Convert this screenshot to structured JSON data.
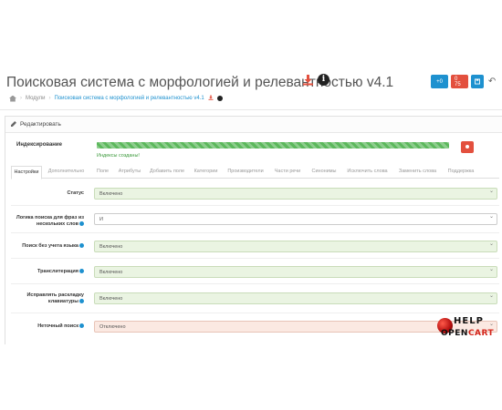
{
  "header": {
    "title": "Поисковая система с морфологией и релевантностью v4.1",
    "buttons": {
      "copy": "+0",
      "delete": "0 75",
      "save": "",
      "back": "↶"
    }
  },
  "breadcrumb": {
    "modules": "Модули",
    "current": "Поисковая система с морфологией и релевантностью v4.1"
  },
  "panel": {
    "heading": "Редактировать"
  },
  "indexing": {
    "label": "Индексирование",
    "status": "Индексы созданы!",
    "progress": 100
  },
  "tabs": [
    "Настройки",
    "Дополнительно",
    "Поле",
    "Атрибуты",
    "Добавить поле",
    "Категории",
    "Производители",
    "Части речи",
    "Синонимы",
    "Исключить слова",
    "Заменить слова",
    "Поддержка"
  ],
  "fields": [
    {
      "label": "Статус",
      "value": "Включено",
      "style": "green",
      "help": false
    },
    {
      "label": "Логика поиска для фраз из нескольких слов",
      "value": "И",
      "style": "plain",
      "help": true
    },
    {
      "label": "Поиск без учета языка",
      "value": "Включено",
      "style": "green",
      "help": true
    },
    {
      "label": "Транслитерация",
      "value": "Включено",
      "style": "green",
      "help": true
    },
    {
      "label": "Исправлять раскладку клавиатуры",
      "value": "Включено",
      "style": "green",
      "help": true
    },
    {
      "label": "Неточный поиск",
      "value": "Отключено",
      "style": "pink",
      "help": true
    }
  ],
  "logo": {
    "line1": "HELP",
    "line2a": "OPEN",
    "line2b": "CART"
  },
  "icons": {
    "download": "download-icon",
    "info": "info-icon",
    "home": "home-icon",
    "pencil": "pencil-icon",
    "help": "question-circle-icon"
  },
  "colors": {
    "primary": "#1e91cf",
    "danger": "#e3503e",
    "success": "#5cb85c"
  }
}
